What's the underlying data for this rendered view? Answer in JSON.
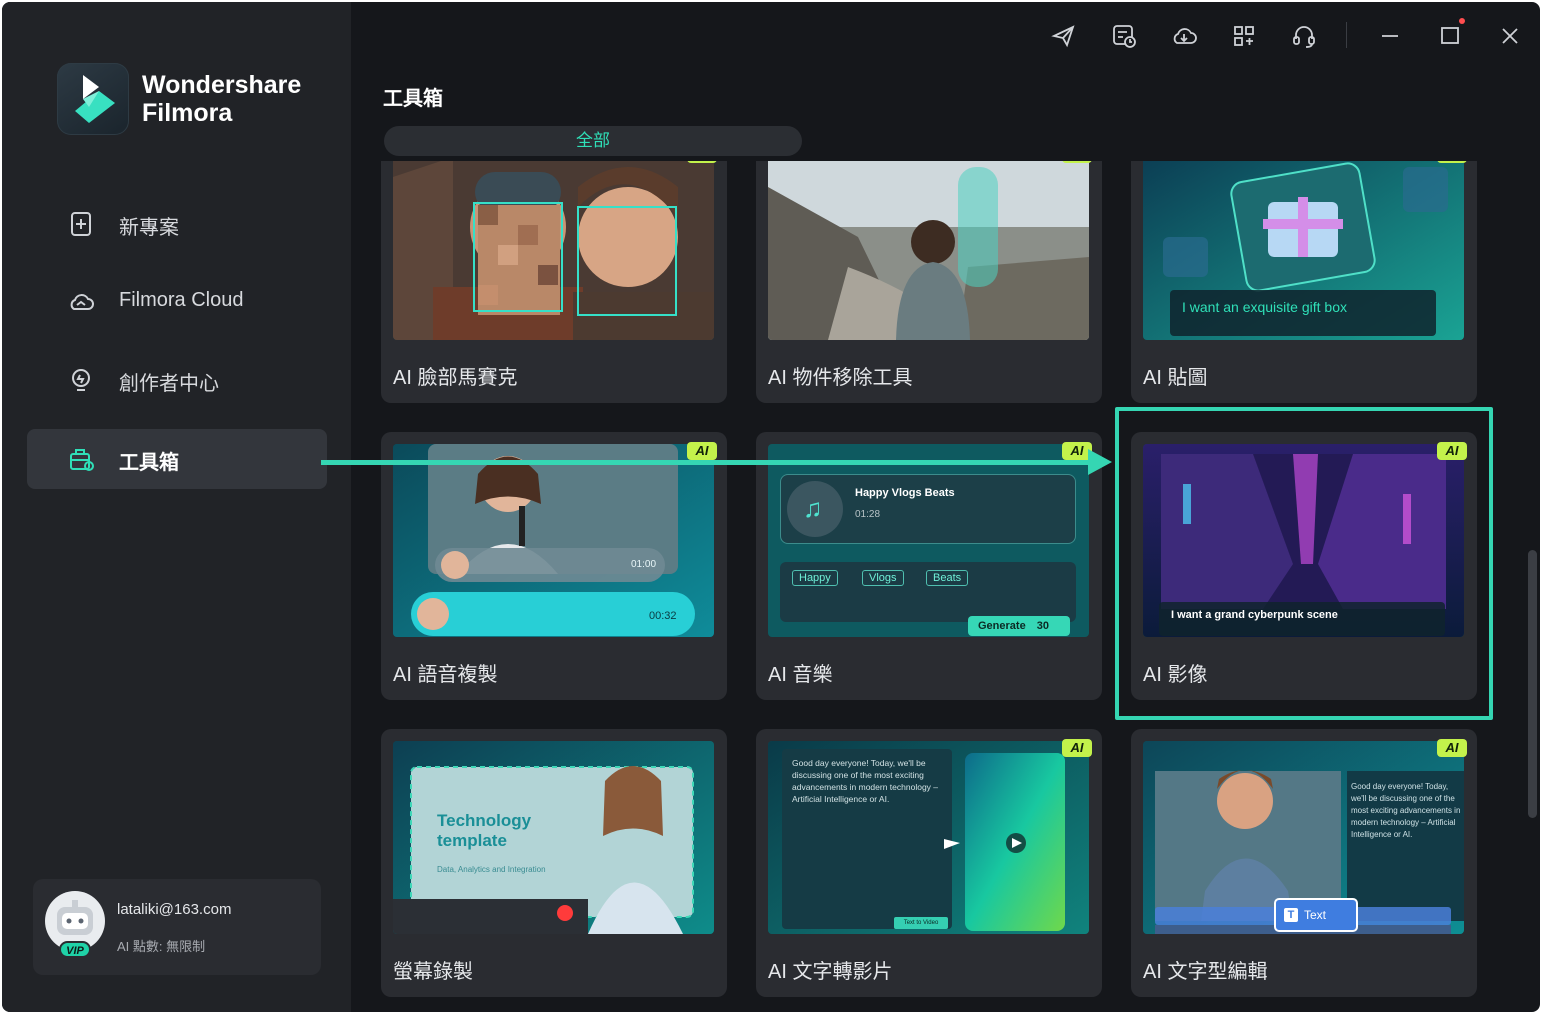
{
  "app": {
    "brand_line1": "Wondershare",
    "brand_line2": "Filmora",
    "accent_color": "#2fe0b8"
  },
  "sidebar": {
    "items": [
      {
        "label": "新專案",
        "icon": "add-project-icon"
      },
      {
        "label": "Filmora Cloud",
        "icon": "cloud-icon"
      },
      {
        "label": "創作者中心",
        "icon": "lightbulb-icon"
      },
      {
        "label": "工具箱",
        "icon": "toolbox-icon",
        "active": true
      }
    ]
  },
  "user": {
    "email": "lataliki@163.com",
    "plan": "AI 點數: 無限制",
    "badge": "VIP"
  },
  "topbar": {
    "icons": [
      "send-icon",
      "task-history-icon",
      "cloud-download-icon",
      "apps-grid-icon",
      "headset-support-icon",
      "minimize-icon",
      "maximize-icon",
      "close-icon"
    ]
  },
  "main": {
    "title": "工具箱",
    "filter_tab": "全部",
    "ai_badge": "AI",
    "cards": [
      {
        "name": "AI 臉部馬賽克",
        "ai": true
      },
      {
        "name": "AI 物件移除工具",
        "ai": true
      },
      {
        "name": "AI 貼圖",
        "ai": true,
        "prompt": "I want an exquisite gift box"
      },
      {
        "name": "AI 語音複製",
        "ai": true,
        "clip_time_1": "01:00",
        "clip_time_2": "00:32"
      },
      {
        "name": "AI 音樂",
        "ai": true,
        "track_title": "Happy Vlogs Beats",
        "track_time": "01:28",
        "tags": [
          "Happy",
          "Vlogs",
          "Beats"
        ],
        "generate_label": "Generate",
        "credits": "30"
      },
      {
        "name": "AI 影像",
        "ai": true,
        "prompt": "I want a grand cyberpunk scene",
        "highlighted": true
      },
      {
        "name": "螢幕錄製",
        "ai": false,
        "template_title": "Technology template",
        "template_sub": "Data, Analytics and Integration"
      },
      {
        "name": "AI 文字轉影片",
        "ai": true,
        "sample_text": "Good day everyone! Today, we'll be discussing one of the most exciting advancements in modern technology – Artificial Intelligence or AI.",
        "button": "Text to Video"
      },
      {
        "name": "AI 文字型編輯",
        "ai": true,
        "text_chip": "Text"
      }
    ]
  }
}
